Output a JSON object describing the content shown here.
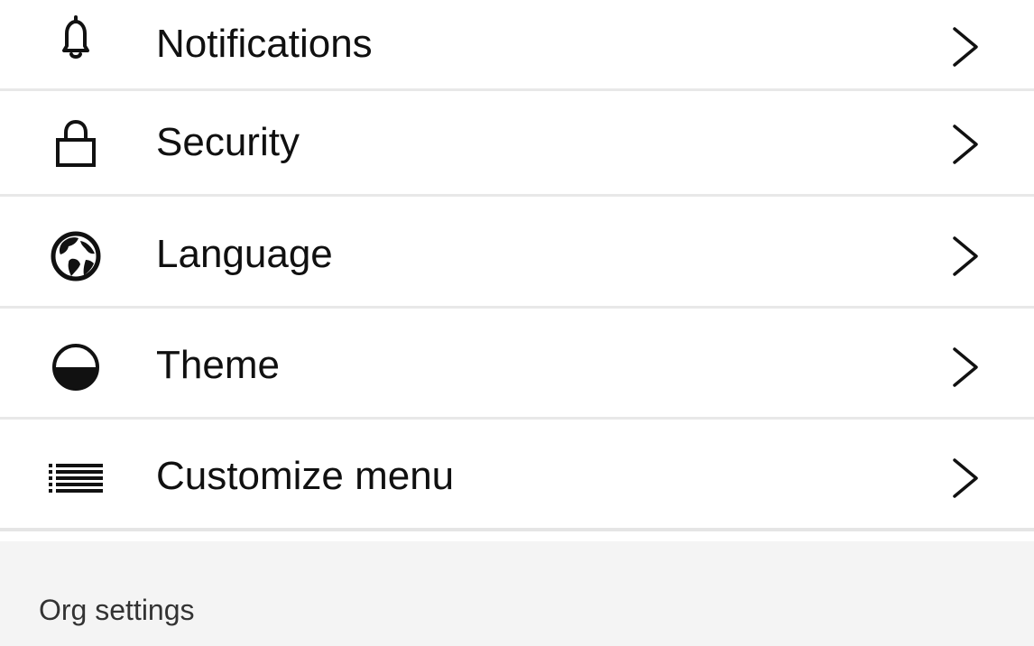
{
  "settings": {
    "items": [
      {
        "label": "Notifications",
        "icon": "bell-icon"
      },
      {
        "label": "Security",
        "icon": "lock-icon"
      },
      {
        "label": "Language",
        "icon": "globe-icon"
      },
      {
        "label": "Theme",
        "icon": "theme-half-circle-icon"
      },
      {
        "label": "Customize menu",
        "icon": "list-icon"
      }
    ]
  },
  "org_section": {
    "label": "Org settings"
  },
  "colors": {
    "background": "#f4f4f4",
    "row_background": "#ffffff",
    "divider": "#e8e8e8",
    "text": "#101010",
    "section_text": "#333333"
  }
}
